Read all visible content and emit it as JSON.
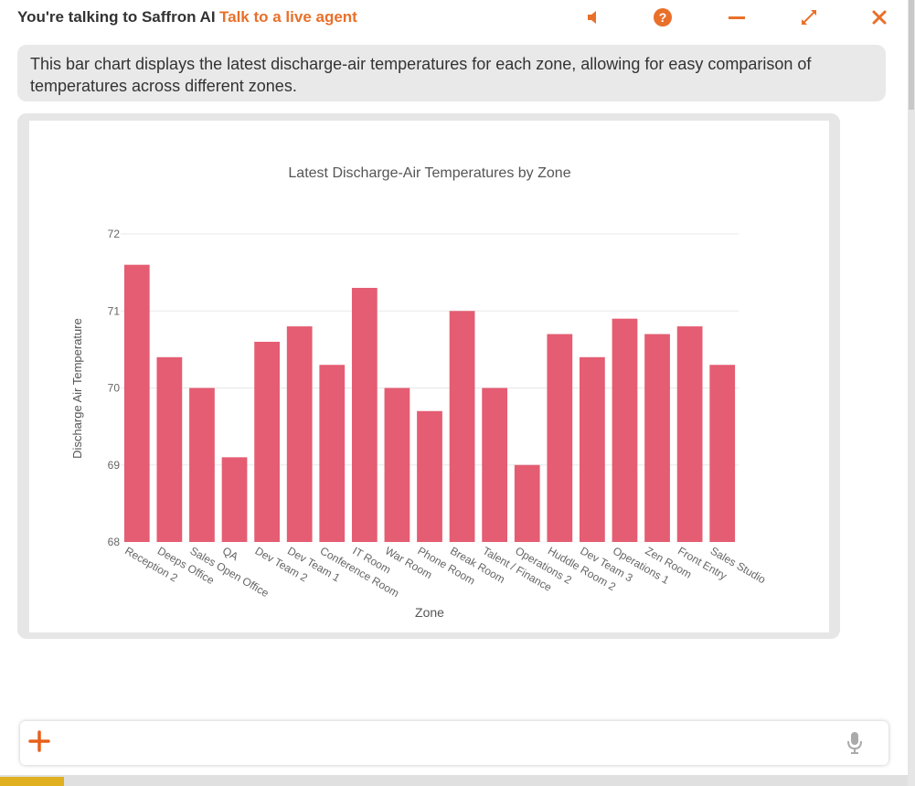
{
  "header": {
    "title": "You're talking to Saffron AI",
    "agent_link": "Talk to a live agent",
    "accent": "#e8702a",
    "icons": [
      "speaker-icon",
      "help-icon",
      "minimize-icon",
      "expand-icon",
      "close-icon"
    ]
  },
  "message": {
    "text": "This bar chart displays the latest discharge-air temperatures for each zone, allowing for easy comparison of temperatures across different zones."
  },
  "composer": {
    "icons": [
      "plus-icon",
      "microphone-icon"
    ]
  },
  "chart_data": {
    "type": "bar",
    "title": "Latest Discharge-Air Temperatures by Zone",
    "xlabel": "Zone",
    "ylabel": "Discharge Air Temperature",
    "ylim": [
      68,
      72
    ],
    "yticks": [
      68,
      69,
      70,
      71,
      72
    ],
    "grid": true,
    "bar_color": "#e45d72",
    "categories": [
      "Reception 2",
      "Deeps Office",
      "Sales Open Office",
      "QA",
      "Dev Team 2",
      "Dev Team 1",
      "Conference Room",
      "IT Room",
      "War Room",
      "Phone Room",
      "Break Room",
      "Talent / Finance",
      "Operations 2",
      "Huddle Room 2",
      "Dev Team 3",
      "Operations 1",
      "Zen Room",
      "Front Entry",
      "Sales Studio"
    ],
    "values": [
      71.6,
      70.4,
      70.0,
      69.1,
      70.6,
      70.8,
      70.3,
      71.3,
      70.0,
      69.7,
      71.0,
      70.0,
      69.0,
      70.7,
      70.4,
      70.9,
      70.7,
      70.8,
      70.3
    ]
  }
}
